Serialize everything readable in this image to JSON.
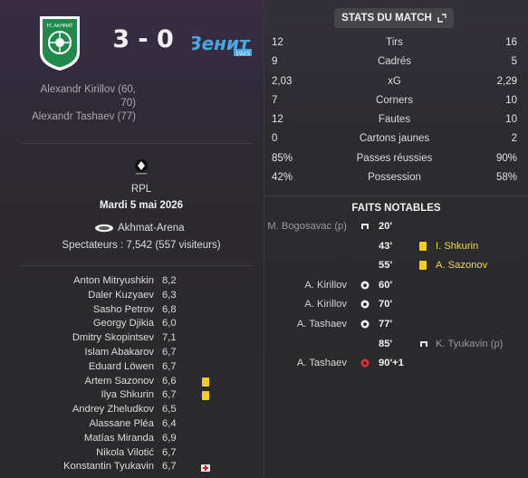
{
  "match": {
    "home_score": "3",
    "separator": "-",
    "away_score": "0",
    "home_badge_text": "FC AKHMAT",
    "away_badge_text": "Зенит",
    "away_badge_year": "1925"
  },
  "scorers": {
    "lines": [
      "Alexandr Kirillov (60,",
      "70)",
      "Alexandr Tashaev (77)"
    ]
  },
  "info": {
    "competition": "RPL",
    "date": "Mardi 5 mai 2026",
    "stadium": "Akhmat-Arena",
    "spectators": "Spectateurs : 7,542 (557 visiteurs)"
  },
  "players": [
    {
      "name": "Anton Mitryushkin",
      "rating": "8,2",
      "mark": ""
    },
    {
      "name": "Daler Kuzyaev",
      "rating": "6,3",
      "mark": ""
    },
    {
      "name": "Sasho Petrov",
      "rating": "6,8",
      "mark": ""
    },
    {
      "name": "Georgy Djikia",
      "rating": "6,0",
      "mark": ""
    },
    {
      "name": "Dmitry Skopintsev",
      "rating": "7,1",
      "mark": ""
    },
    {
      "name": "Islam Abakarov",
      "rating": "6,7",
      "mark": ""
    },
    {
      "name": "Eduard Löwen",
      "rating": "6,7",
      "mark": ""
    },
    {
      "name": "Artem Sazonov",
      "rating": "6,6",
      "mark": "yellow-card"
    },
    {
      "name": "Ilya Shkurin",
      "rating": "6,7",
      "mark": "yellow-card"
    },
    {
      "name": "Andrey Zheludkov",
      "rating": "6,5",
      "mark": ""
    },
    {
      "name": "Alassane Pléa",
      "rating": "6,4",
      "mark": ""
    },
    {
      "name": "Matías Miranda",
      "rating": "6,9",
      "mark": ""
    },
    {
      "name": "Nikola Vilotić",
      "rating": "6,7",
      "mark": ""
    },
    {
      "name": "Konstantin Tyukavin",
      "rating": "6,7",
      "mark": "injury"
    }
  ],
  "stats": {
    "title": "STATS DU MATCH",
    "rows": [
      {
        "home": "12",
        "label": "Tirs",
        "away": "16"
      },
      {
        "home": "9",
        "label": "Cadrés",
        "away": "5"
      },
      {
        "home": "2,03",
        "label": "xG",
        "away": "2,29"
      },
      {
        "home": "7",
        "label": "Corners",
        "away": "10"
      },
      {
        "home": "12",
        "label": "Fautes",
        "away": "10"
      },
      {
        "home": "0",
        "label": "Cartons jaunes",
        "away": "2"
      },
      {
        "home": "85%",
        "label": "Passes réussies",
        "away": "90%"
      },
      {
        "home": "42%",
        "label": "Possession",
        "away": "58%"
      }
    ]
  },
  "events": {
    "title": "FAITS NOTABLES",
    "rows": [
      {
        "home_player": "M. Bogosavac (p)",
        "home_icon": "injury-icon",
        "minute": "20'",
        "away_icon": "",
        "away_player": ""
      },
      {
        "home_player": "",
        "home_icon": "",
        "minute": "43'",
        "away_icon": "yellow-card",
        "away_player": "I. Shkurin"
      },
      {
        "home_player": "",
        "home_icon": "",
        "minute": "55'",
        "away_icon": "yellow-card",
        "away_player": "A. Sazonov"
      },
      {
        "home_player": "A. Kirillov",
        "home_icon": "goal-ball-icon",
        "minute": "60'",
        "away_icon": "",
        "away_player": ""
      },
      {
        "home_player": "A. Kirillov",
        "home_icon": "goal-ball-icon",
        "minute": "70'",
        "away_icon": "",
        "away_player": ""
      },
      {
        "home_player": "A. Tashaev",
        "home_icon": "goal-ball-icon",
        "minute": "77'",
        "away_icon": "",
        "away_player": ""
      },
      {
        "home_player": "",
        "home_icon": "",
        "minute": "85'",
        "away_icon": "injury-icon",
        "away_player": "K. Tyukavin (p)"
      },
      {
        "home_player": "A. Tashaev",
        "home_icon": "missed-ball-icon",
        "minute": "90'+1",
        "away_icon": "",
        "away_player": ""
      }
    ]
  },
  "colors": {
    "yellow_card": "#f2d017",
    "home_badge_green": "#1f8a4c",
    "away_badge_blue": "#4aa6e0"
  }
}
